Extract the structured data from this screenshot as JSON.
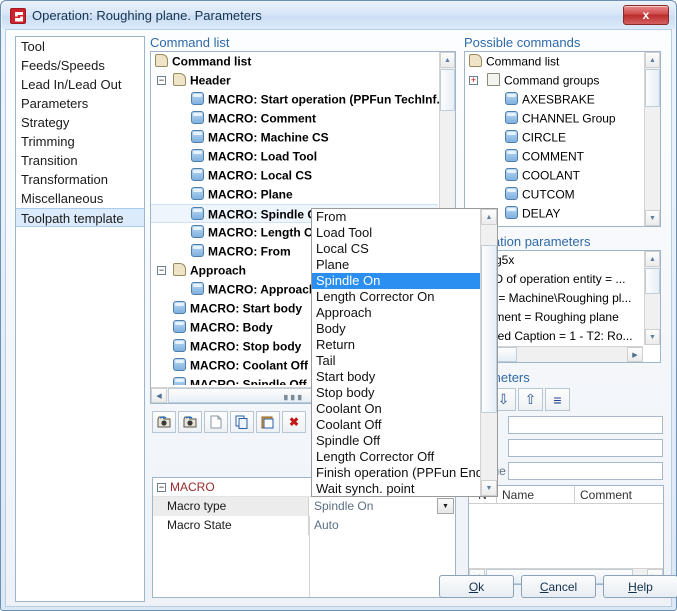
{
  "window": {
    "title": "Operation: Roughing plane. Parameters",
    "close_label": "x",
    "app_icon": "red-logo-icon"
  },
  "sidebar": {
    "items": [
      {
        "label": "Tool",
        "selected": false
      },
      {
        "label": "Feeds/Speeds",
        "selected": false
      },
      {
        "label": "Lead In/Lead Out",
        "selected": false
      },
      {
        "label": "Parameters",
        "selected": false
      },
      {
        "label": "Strategy",
        "selected": false
      },
      {
        "label": "Trimming",
        "selected": false
      },
      {
        "label": "Transition",
        "selected": false
      },
      {
        "label": "Transformation",
        "selected": false
      },
      {
        "label": "Miscellaneous",
        "selected": false
      },
      {
        "label": "Toolpath template",
        "selected": true
      }
    ]
  },
  "command_list": {
    "caption": "Command list",
    "nodes": [
      {
        "label": "Command list",
        "level": 1,
        "icon": "scroll-icon",
        "bold": true,
        "expander": null
      },
      {
        "label": "Header",
        "level": 2,
        "icon": "scroll-icon",
        "bold": true,
        "expander": "minus"
      },
      {
        "label": "MACRO: Start operation (PPFun TechInf...",
        "level": 3,
        "icon": "cylinder-icon",
        "bold": true,
        "expander": null
      },
      {
        "label": "MACRO: Comment",
        "level": 3,
        "icon": "cylinder-icon",
        "bold": true,
        "expander": null
      },
      {
        "label": "MACRO: Machine CS",
        "level": 3,
        "icon": "cylinder-icon",
        "bold": true,
        "expander": null
      },
      {
        "label": "MACRO: Load Tool",
        "level": 3,
        "icon": "cylinder-icon",
        "bold": true,
        "expander": null
      },
      {
        "label": "MACRO: Local CS",
        "level": 3,
        "icon": "cylinder-icon",
        "bold": true,
        "expander": null
      },
      {
        "label": "MACRO: Plane",
        "level": 3,
        "icon": "cylinder-icon",
        "bold": true,
        "expander": null
      },
      {
        "label": "MACRO: Spindle On",
        "level": 3,
        "icon": "cylinder-icon",
        "bold": true,
        "expander": null,
        "selected": true
      },
      {
        "label": "MACRO: Length Corrector On",
        "level": 3,
        "icon": "cylinder-icon",
        "bold": true,
        "expander": null
      },
      {
        "label": "MACRO: From",
        "level": 3,
        "icon": "cylinder-icon",
        "bold": true,
        "expander": null
      },
      {
        "label": "Approach",
        "level": 2,
        "icon": "scroll-icon",
        "bold": true,
        "expander": "minus"
      },
      {
        "label": "MACRO: Approach",
        "level": 3,
        "icon": "cylinder-icon",
        "bold": true,
        "expander": null
      },
      {
        "label": "MACRO: Start body",
        "level": 2,
        "icon": "cylinder-icon",
        "bold": true,
        "expander": null
      },
      {
        "label": "MACRO: Body",
        "level": 2,
        "icon": "cylinder-icon",
        "bold": true,
        "expander": null
      },
      {
        "label": "MACRO: Stop body",
        "level": 2,
        "icon": "cylinder-icon",
        "bold": true,
        "expander": null
      },
      {
        "label": "MACRO: Coolant Off",
        "level": 2,
        "icon": "cylinder-icon",
        "bold": true,
        "expander": null
      },
      {
        "label": "MACRO: Spindle Off",
        "level": 2,
        "icon": "cylinder-icon",
        "bold": true,
        "expander": null
      }
    ]
  },
  "possible_commands": {
    "caption": "Possible commands",
    "nodes": [
      {
        "label": "Command list",
        "level": 1,
        "icon": "scroll-icon",
        "expander": null
      },
      {
        "label": "Command groups",
        "level": 2,
        "icon": "doc-icon",
        "expander": "plus"
      },
      {
        "label": "AXESBRAKE",
        "level": 3,
        "icon": "cylinder-icon",
        "expander": null
      },
      {
        "label": "CHANNEL Group",
        "level": 3,
        "icon": "cylinder-icon",
        "expander": null
      },
      {
        "label": "CIRCLE",
        "level": 3,
        "icon": "cylinder-icon",
        "expander": null
      },
      {
        "label": "COMMENT",
        "level": 3,
        "icon": "cylinder-icon",
        "expander": null
      },
      {
        "label": "COOLANT",
        "level": 3,
        "icon": "cylinder-icon",
        "expander": null
      },
      {
        "label": "CUTCOM",
        "level": 3,
        "icon": "cylinder-icon",
        "expander": null
      },
      {
        "label": "DELAY",
        "level": 3,
        "icon": "cylinder-icon",
        "expander": null
      }
    ]
  },
  "operation_parameters": {
    "caption": "Operation parameters",
    "caption_visible": "ation parameters",
    "items": [
      "lomag5x",
      "Inic ID of operation entity = ...",
      "lame = Machine\\Roughing pl...",
      "Comment = Roughing plane",
      "Masked Caption = 1 - T2: Ro..."
    ]
  },
  "command_parameters": {
    "caption": "parameters",
    "toolbar": [
      {
        "name": "delete-icon",
        "glyph": "✖",
        "color": "#c21a1a"
      },
      {
        "name": "move-down-icon",
        "glyph": "⇩",
        "color": "#2a4f8f"
      },
      {
        "name": "move-up-icon",
        "glyph": "⇧",
        "color": "#2a4f8f"
      },
      {
        "name": "align-icon",
        "glyph": "≡",
        "color": "#1f3f8f"
      }
    ],
    "fields": [
      {
        "label": "",
        "value": ""
      },
      {
        "label": "",
        "value": ""
      },
      {
        "label": "Value",
        "value": ""
      }
    ],
    "table": {
      "columns": [
        "N",
        "Name",
        "Comment"
      ],
      "rows": []
    }
  },
  "macro_grid": {
    "group_label": "MACRO",
    "group_expander": "minus",
    "rows": [
      {
        "name": "Macro type",
        "value": "Spindle On",
        "has_combo": true,
        "selected": true
      },
      {
        "name": "Macro State",
        "value": "Auto",
        "has_combo": false,
        "selected": false
      }
    ]
  },
  "tree_toolbar": [
    {
      "name": "import-camera-icon",
      "glyph": "📷"
    },
    {
      "name": "export-camera-icon",
      "glyph": "📷"
    },
    {
      "name": "new-icon",
      "glyph": "⬜"
    },
    {
      "name": "copy-icon",
      "glyph": "⧉"
    },
    {
      "name": "paste-icon",
      "glyph": "📋"
    },
    {
      "name": "delete-icon",
      "glyph": "✖"
    }
  ],
  "dropdown": {
    "selected": "Spindle On",
    "items": [
      "From",
      "Load Tool",
      "Local CS",
      "Plane",
      "Spindle On",
      "Length Corrector On",
      "Approach",
      "Body",
      "Return",
      "Tail",
      "Start body",
      "Stop body",
      "Coolant On",
      "Coolant Off",
      "Spindle Off",
      "Length Corrector Off",
      "Finish operation (PPFun EndTe",
      "Wait synch. point"
    ]
  },
  "buttons": {
    "ok": "Ok",
    "cancel": "Cancel",
    "help": "Help"
  },
  "colors": {
    "caption_blue": "#2f6aa8",
    "selection_blue": "#2a8ff0",
    "title_red": "#d0222a"
  }
}
